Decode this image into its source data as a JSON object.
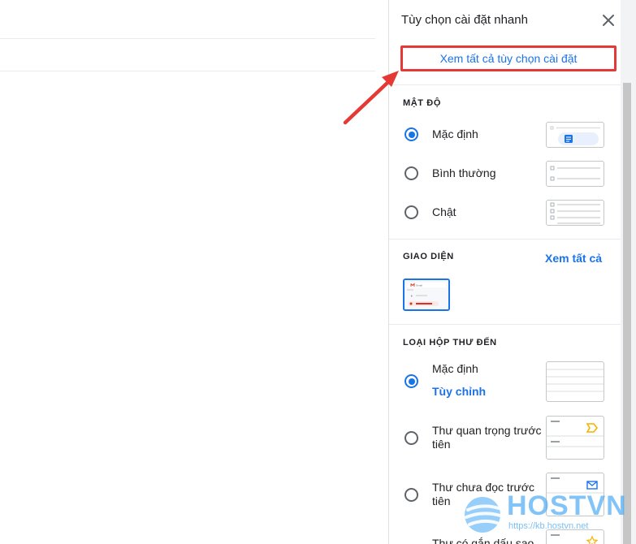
{
  "panel": {
    "title": "Tùy chọn cài đặt nhanh",
    "see_all_settings": "Xem tất cả tùy chọn cài đặt"
  },
  "density": {
    "title": "MẬT ĐỘ",
    "options": [
      {
        "label": "Mặc định",
        "checked": true
      },
      {
        "label": "Bình thường",
        "checked": false
      },
      {
        "label": "Chật",
        "checked": false
      }
    ]
  },
  "theme": {
    "title": "GIAO DIỆN",
    "see_all": "Xem tất cả",
    "thumb_brand": "Gmail"
  },
  "inbox_type": {
    "title": "LOẠI HỘP THƯ ĐẾN",
    "options": [
      {
        "label": "Mặc định",
        "sublink": "Tùy chỉnh",
        "checked": true
      },
      {
        "label": "Thư quan trọng trước tiên",
        "checked": false
      },
      {
        "label": "Thư chưa đọc trước tiên",
        "checked": false
      },
      {
        "label": "Thư có gắn dấu sao",
        "checked": false
      }
    ]
  },
  "watermark": {
    "brand": "HOSTVN",
    "url": "https://kb.hostvn.net"
  },
  "colors": {
    "accent": "#1a73e8",
    "highlight": "#e53935",
    "important_marker": "#f4b400"
  }
}
